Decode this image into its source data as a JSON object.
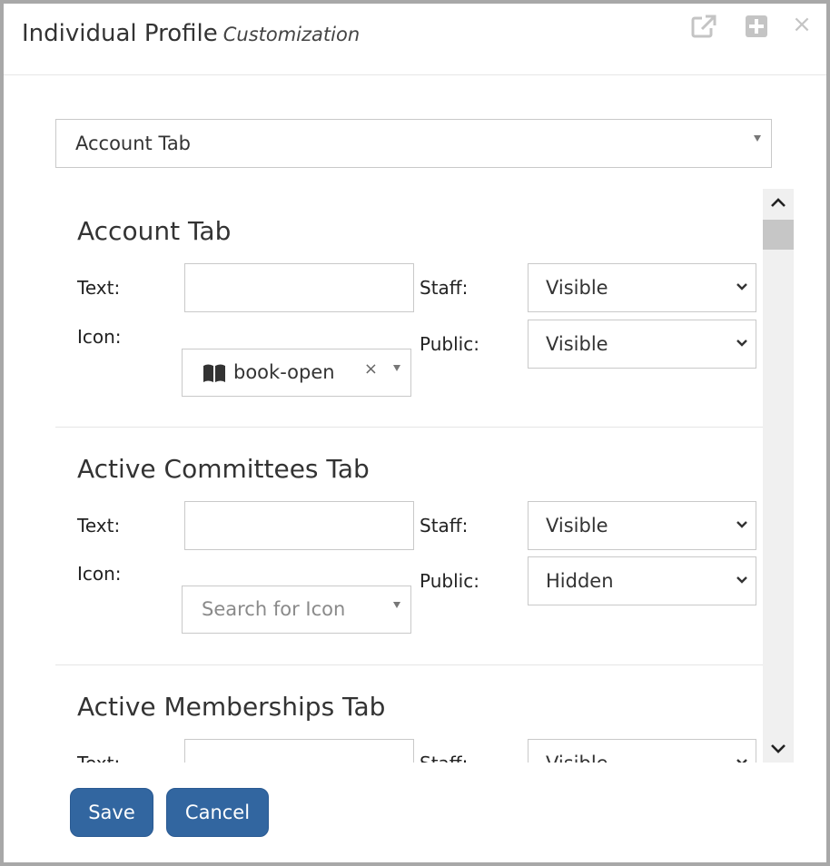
{
  "dialog": {
    "title": "Individual Profile",
    "subtitle": "Customization",
    "header_icons": [
      "external-link-icon",
      "plus-square-icon",
      "close-icon"
    ],
    "close_glyph": "×"
  },
  "tab_picker": {
    "value": "Account Tab"
  },
  "labels": {
    "text": "Text:",
    "icon": "Icon:",
    "staff": "Staff:",
    "public": "Public:"
  },
  "sections": [
    {
      "title": "Account Tab",
      "text_value": "",
      "icon": {
        "value": "book-open",
        "clear_glyph": "×"
      },
      "staff": "Visible",
      "public": "Visible"
    },
    {
      "title": "Active Committees Tab",
      "text_value": "",
      "icon": {
        "placeholder": "Search for Icon"
      },
      "staff": "Visible",
      "public": "Hidden"
    },
    {
      "title": "Active Memberships Tab",
      "text_value": "",
      "staff": "Visible"
    }
  ],
  "buttons": {
    "save": "Save",
    "cancel": "Cancel"
  },
  "colors": {
    "primary_button": "#3266a0",
    "scrollbar_track": "#f0f0f0",
    "scrollbar_thumb": "#c6c6c6"
  }
}
